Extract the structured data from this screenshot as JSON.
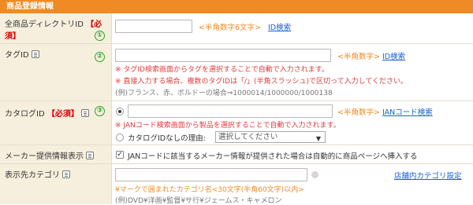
{
  "header": {
    "title": "商品登録情報"
  },
  "row1": {
    "label": "全商品ディレクトリID",
    "required": "【必須】",
    "badge": "①",
    "hint": "<半角数字6文字>",
    "link": "ID検索",
    "input_value": ""
  },
  "row2": {
    "label": "タグID",
    "badge": "②",
    "hint": "<半角数字>",
    "link": "ID検索",
    "note1": "※ タグID検索画面からタグを選択することで自動で入力されます。",
    "note2": "※ 直接入力する場合、複数のタグIDは「/」(半角スラッシュ)で区切って入力してください。",
    "example": "(例)フランス、赤、ボルドーの場合⇒1000014/1000000/1000138",
    "input_value": ""
  },
  "row3": {
    "label": "カタログID",
    "required": "【必須】",
    "badge": "③",
    "hint": "<半角数字>",
    "link": "JANコード検索",
    "note": "※ JANコード検索画面から製品を選択することで自動で入力されます。",
    "no_catalog_label": "カタログIDなしの理由:",
    "select_value": "選択してください",
    "input_value": ""
  },
  "row4": {
    "label": "メーカー提供情報表示",
    "checkbox_label": "JANコードに該当するメーカー情報が提供された場合は自動的に商品ページへ挿入する",
    "checked": true
  },
  "row5": {
    "label": "表示先カテゴリ",
    "link": "店舗内カテゴリ設定",
    "hint": "¥マークで囲まれたカテゴリ名<30文字(半角60文字)以内>",
    "example": "(例)DVD¥洋画¥監督¥サ行¥ジェームス・キャメロン",
    "input_value": ""
  }
}
